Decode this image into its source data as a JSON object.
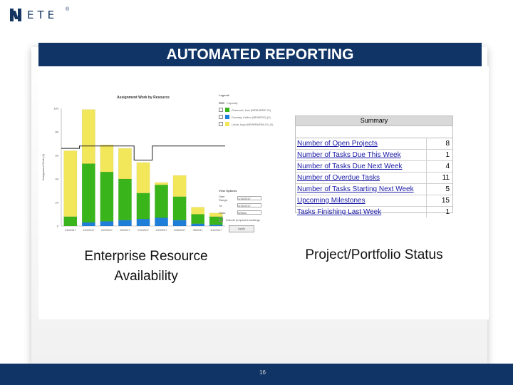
{
  "logo": {
    "text": "ETE",
    "registered": "®"
  },
  "slide": {
    "title": "AUTOMATED REPORTING",
    "caption_left": "Enterprise Resource Availability",
    "caption_right": "Project/Portfolio Status",
    "page_number": "16"
  },
  "chart_data": {
    "type": "bar",
    "title": "Assignment Work by Resource",
    "ylabel": "Assignment Work (h)",
    "xlabel": "",
    "categories": [
      "1/15/2017",
      "1/22/2017",
      "1/29/2017",
      "2/5/2017",
      "2/12/2017",
      "2/19/2017",
      "2/26/2017",
      "3/5/2017",
      "3/12/2017"
    ],
    "ylim": [
      0,
      100
    ],
    "yticks": [
      0,
      20,
      40,
      60,
      80,
      100
    ],
    "series": [
      {
        "name": "",
        "color": "#1f7ed8",
        "values": [
          0,
          3,
          4,
          5,
          6,
          7,
          5,
          2,
          1
        ]
      },
      {
        "name": "",
        "color": "#39b51b",
        "values": [
          8,
          50,
          42,
          35,
          22,
          28,
          20,
          8,
          7
        ]
      },
      {
        "name": "",
        "color": "#f2e65a",
        "values": [
          56,
          46,
          23,
          26,
          26,
          2,
          18,
          6,
          3
        ]
      }
    ],
    "capacity": [
      66,
      68,
      68,
      68,
      56,
      68,
      68,
      68,
      68
    ],
    "capacity_color": "#222222",
    "grid": false
  },
  "legend": {
    "title": "Legend:",
    "items": [
      {
        "label": "Capacity",
        "color": "#111111",
        "type": "line"
      },
      {
        "label": "Grønvold, Kari (BIRB4RRP-01)",
        "color": "#39b51b",
        "type": "box"
      },
      {
        "label": "Dunawy, Keffen (BEWRD0) (2)",
        "color": "#1f7ed8",
        "type": "box"
      },
      {
        "label": "Linda, Ingo (BEWRB4RM-01) (2)",
        "color": "#f2e65a",
        "type": "box"
      }
    ]
  },
  "view_options": {
    "title": "View Options",
    "rows": [
      {
        "label": "Date Range:",
        "value": "1/15/2017"
      },
      {
        "label": "To:",
        "value": "3/15/2017"
      },
      {
        "label": "Units:",
        "value": "Weeks"
      }
    ],
    "checkbox": "Include proposed bookings",
    "apply": "Apply"
  },
  "summary": {
    "title": "Summary",
    "rows": [
      {
        "label": "Number of Open Projects",
        "value": "8"
      },
      {
        "label": "Number of Tasks Due This Week",
        "value": "1"
      },
      {
        "label": "Number of Tasks Due Next Week",
        "value": "4"
      },
      {
        "label": "Number of Overdue Tasks",
        "value": "11"
      },
      {
        "label": "Number of Tasks Starting Next Week",
        "value": "5"
      },
      {
        "label": "Upcoming Milestones",
        "value": "15"
      },
      {
        "label": "Tasks Finishing Last Week",
        "value": "1"
      }
    ]
  }
}
